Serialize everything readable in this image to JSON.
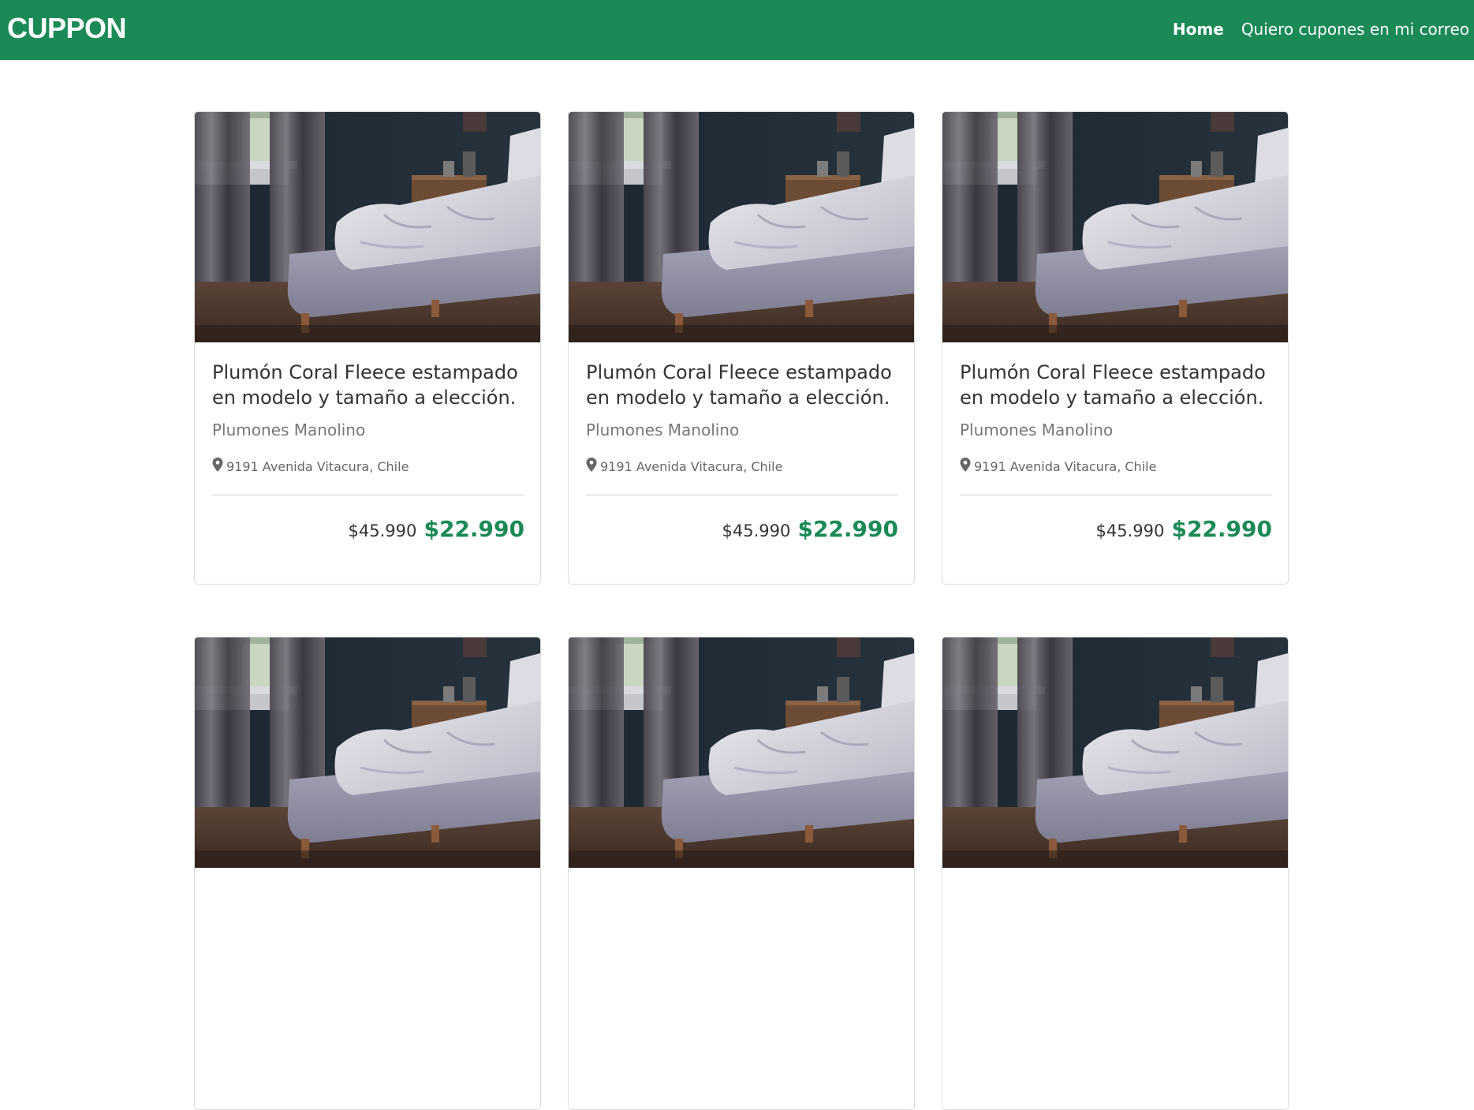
{
  "navbar": {
    "brand": "CUPPON",
    "links": [
      {
        "label": "Home",
        "active": true
      },
      {
        "label": "Quiero cupones en mi correo",
        "active": false
      }
    ],
    "background": "#1b8a56"
  },
  "offers": [
    {
      "title": "Plumón Coral Fleece estampado en modelo y tamaño a elección.",
      "merchant": "Plumones Manolino",
      "location": "9191 Avenida Vitacura, Chile",
      "price_old": "$45.990",
      "price_new": "$22.990"
    },
    {
      "title": "Plumón Coral Fleece estampado en modelo y tamaño a elección.",
      "merchant": "Plumones Manolino",
      "location": "9191 Avenida Vitacura, Chile",
      "price_old": "$45.990",
      "price_new": "$22.990"
    },
    {
      "title": "Plumón Coral Fleece estampado en modelo y tamaño a elección.",
      "merchant": "Plumones Manolino",
      "location": "9191 Avenida Vitacura, Chile",
      "price_old": "$45.990",
      "price_new": "$22.990"
    },
    {
      "title": "",
      "merchant": "",
      "location": "",
      "price_old": "",
      "price_new": ""
    },
    {
      "title": "",
      "merchant": "",
      "location": "",
      "price_old": "",
      "price_new": ""
    },
    {
      "title": "",
      "merchant": "",
      "location": "",
      "price_old": "",
      "price_new": ""
    }
  ],
  "colors": {
    "accent": "#1b8a56",
    "text": "#333333",
    "muted": "#777777"
  },
  "icons": {
    "location": "map-marker-icon"
  }
}
